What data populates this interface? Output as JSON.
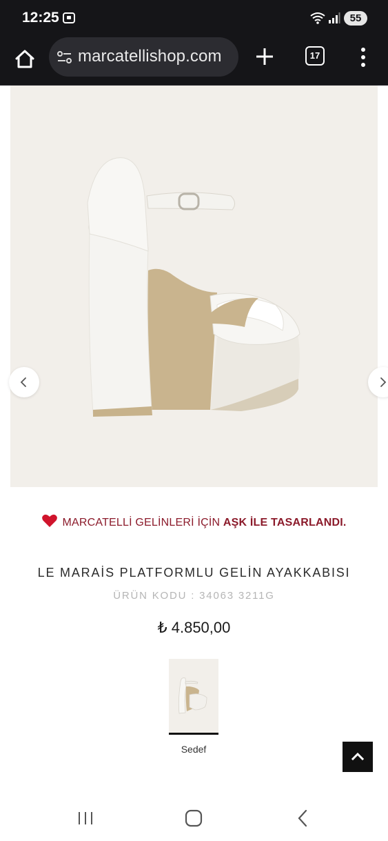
{
  "status_bar": {
    "time": "12:25",
    "battery": "55"
  },
  "browser": {
    "url": "marcatellishop.com",
    "tab_count": "17"
  },
  "promo": {
    "prefix": "MARCATELLİ GELİNLERİ İÇİN ",
    "emphasis": "AŞK İLE TASARLANDI."
  },
  "product": {
    "title": "LE MARAİS PLATFORMLU GELİN AYAKKABISI",
    "code": "ÜRÜN KODU : 34063 3211G",
    "price": "₺ 4.850,00",
    "variants": [
      {
        "label": "Sedef",
        "selected": true
      }
    ]
  },
  "icons": {
    "home": "home-icon",
    "site_info": "tune-icon",
    "new_tab": "plus-icon",
    "menu": "more-vert-icon",
    "prev": "chevron-left-icon",
    "next": "chevron-right-icon",
    "heart": "heart-icon",
    "back_to_top": "chevron-up-icon"
  },
  "colors": {
    "accent": "#8b1a2a",
    "heart": "#d0142c",
    "image_bg": "#f2efea",
    "chrome_bg": "#151518"
  }
}
